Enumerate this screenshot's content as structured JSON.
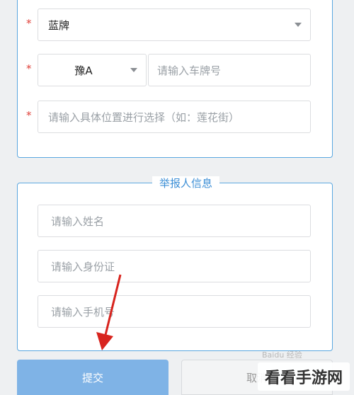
{
  "colors": {
    "accent": "#5aa7e0",
    "required": "#e0413a",
    "submit_bg": "#7fb3e6"
  },
  "vehicle": {
    "plate_type": {
      "value": "蓝牌",
      "icon": "caret-down-icon"
    },
    "province": {
      "value": "豫A",
      "icon": "caret-down-icon"
    },
    "plate_number": {
      "placeholder": "请输入车牌号"
    },
    "location": {
      "placeholder": "请输入具体位置进行选择（如：莲花街）"
    },
    "required_mark": "*"
  },
  "reporter": {
    "title": "举报人信息",
    "name": {
      "placeholder": "请输入姓名"
    },
    "id_card": {
      "placeholder": "请输入身份证"
    },
    "phone": {
      "placeholder": "请输入手机号"
    }
  },
  "actions": {
    "submit_label": "提交",
    "second_label": "取消"
  },
  "watermark": "看看手游网",
  "faint_watermark": "Baidu 经验"
}
